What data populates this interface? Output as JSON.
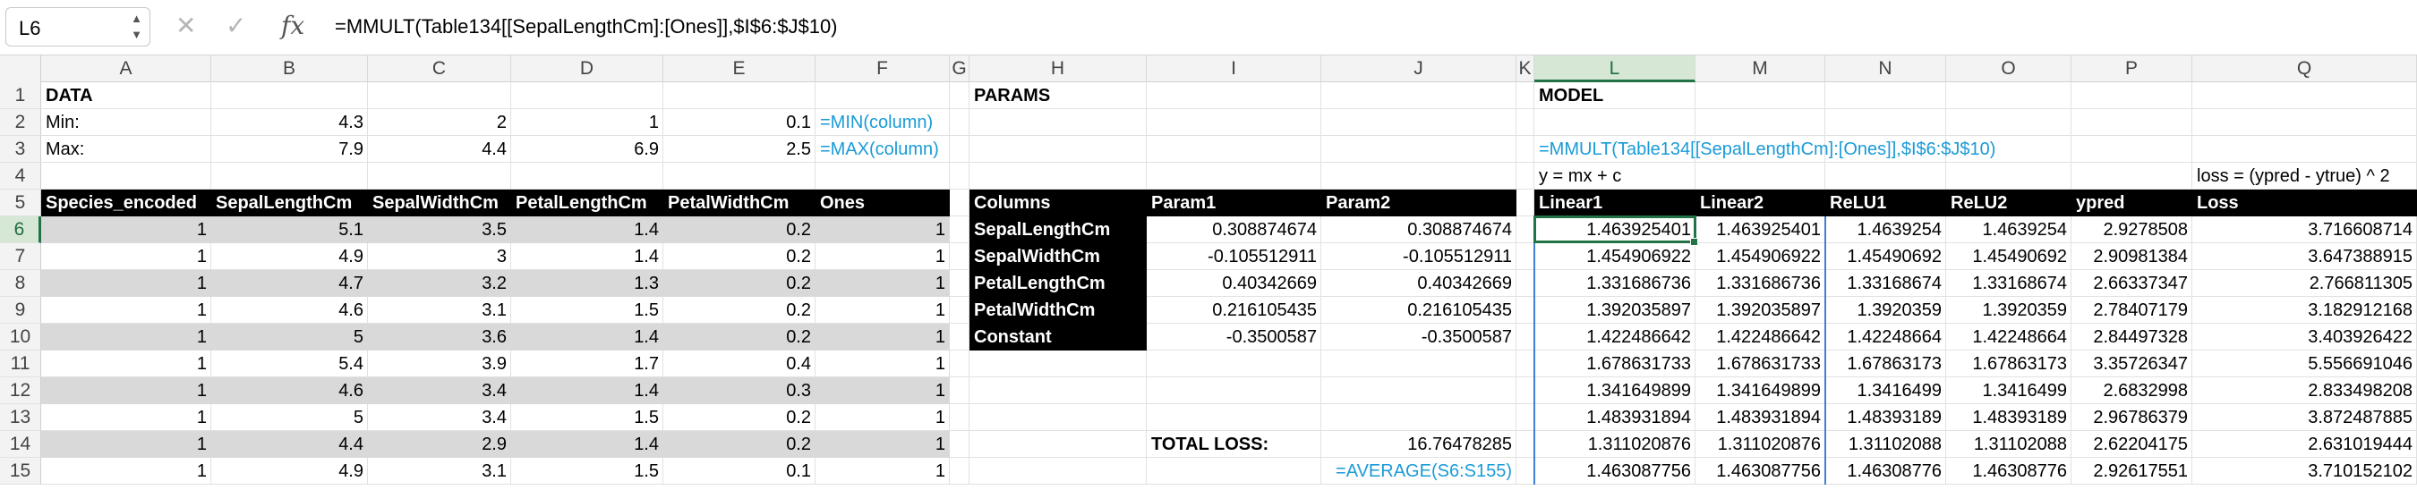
{
  "formula_bar": {
    "name_box": "L6",
    "cancel_icon": "✕",
    "enter_icon": "✓",
    "fx_label": "fx",
    "formula": "=MMULT(Table134[[SepalLengthCm]:[Ones]],$I$6:$J$10)"
  },
  "columns": [
    "A",
    "B",
    "C",
    "D",
    "E",
    "F",
    "G",
    "H",
    "I",
    "J",
    "K",
    "L",
    "M",
    "N",
    "O",
    "P",
    "Q"
  ],
  "rows": [
    "1",
    "2",
    "3",
    "4",
    "5",
    "6",
    "7",
    "8",
    "9",
    "10",
    "11",
    "12",
    "13",
    "14",
    "15"
  ],
  "data_section": {
    "title": "DATA",
    "min_label": "Min:",
    "max_label": "Max:",
    "min_values": [
      "4.3",
      "2",
      "1",
      "0.1"
    ],
    "max_values": [
      "7.9",
      "4.4",
      "6.9",
      "2.5"
    ],
    "min_note": "=MIN(column)",
    "max_note": "=MAX(column)",
    "headers": [
      "Species_encoded",
      "SepalLengthCm",
      "SepalWidthCm",
      "PetalLengthCm",
      "PetalWidthCm",
      "Ones"
    ],
    "rows": [
      [
        "1",
        "5.1",
        "3.5",
        "1.4",
        "0.2",
        "1"
      ],
      [
        "1",
        "4.9",
        "3",
        "1.4",
        "0.2",
        "1"
      ],
      [
        "1",
        "4.7",
        "3.2",
        "1.3",
        "0.2",
        "1"
      ],
      [
        "1",
        "4.6",
        "3.1",
        "1.5",
        "0.2",
        "1"
      ],
      [
        "1",
        "5",
        "3.6",
        "1.4",
        "0.2",
        "1"
      ],
      [
        "1",
        "5.4",
        "3.9",
        "1.7",
        "0.4",
        "1"
      ],
      [
        "1",
        "4.6",
        "3.4",
        "1.4",
        "0.3",
        "1"
      ],
      [
        "1",
        "5",
        "3.4",
        "1.5",
        "0.2",
        "1"
      ],
      [
        "1",
        "4.4",
        "2.9",
        "1.4",
        "0.2",
        "1"
      ],
      [
        "1",
        "4.9",
        "3.1",
        "1.5",
        "0.1",
        "1"
      ]
    ]
  },
  "params_section": {
    "title": "PARAMS",
    "headers": [
      "Columns",
      "Param1",
      "Param2"
    ],
    "rows": [
      [
        "SepalLengthCm",
        "0.308874674",
        "0.308874674"
      ],
      [
        "SepalWidthCm",
        "-0.105512911",
        "-0.105512911"
      ],
      [
        "PetalLengthCm",
        "0.40342669",
        "0.40342669"
      ],
      [
        "PetalWidthCm",
        "0.216105435",
        "0.216105435"
      ],
      [
        "Constant",
        "-0.3500587",
        "-0.3500587"
      ]
    ],
    "total_loss_label": "TOTAL LOSS:",
    "total_loss_value": "16.76478285",
    "total_loss_note": "=AVERAGE(S6:S155)"
  },
  "model_section": {
    "title": "MODEL",
    "formula_note": "=MMULT(Table134[[SepalLengthCm]:[Ones]],$I$6:$J$10)",
    "equation": "y = mx + c",
    "loss_note": "loss = (ypred - ytrue) ^ 2",
    "headers": [
      "Linear1",
      "Linear2",
      "ReLU1",
      "ReLU2",
      "ypred",
      "Loss"
    ],
    "rows": [
      [
        "1.463925401",
        "1.463925401",
        "1.4639254",
        "1.4639254",
        "2.9278508",
        "3.716608714"
      ],
      [
        "1.454906922",
        "1.454906922",
        "1.45490692",
        "1.45490692",
        "2.90981384",
        "3.647388915"
      ],
      [
        "1.331686736",
        "1.331686736",
        "1.33168674",
        "1.33168674",
        "2.66337347",
        "2.766811305"
      ],
      [
        "1.392035897",
        "1.392035897",
        "1.3920359",
        "1.3920359",
        "2.78407179",
        "3.182912168"
      ],
      [
        "1.422486642",
        "1.422486642",
        "1.42248664",
        "1.42248664",
        "2.84497328",
        "3.403926422"
      ],
      [
        "1.678631733",
        "1.678631733",
        "1.67863173",
        "1.67863173",
        "3.35726347",
        "5.556691046"
      ],
      [
        "1.341649899",
        "1.341649899",
        "1.3416499",
        "1.3416499",
        "2.6832998",
        "2.833498208"
      ],
      [
        "1.483931894",
        "1.483931894",
        "1.48393189",
        "1.48393189",
        "2.96786379",
        "3.872487885"
      ],
      [
        "1.311020876",
        "1.311020876",
        "1.31102088",
        "1.31102088",
        "2.62204175",
        "2.631019444"
      ],
      [
        "1.463087756",
        "1.463087756",
        "1.46308776",
        "1.46308776",
        "2.92617551",
        "3.710152102"
      ]
    ]
  },
  "colors": {
    "accent_green": "#217346",
    "note_blue": "#1a9bd7",
    "band_gray": "#d9d9d9",
    "header_black": "#000000"
  }
}
